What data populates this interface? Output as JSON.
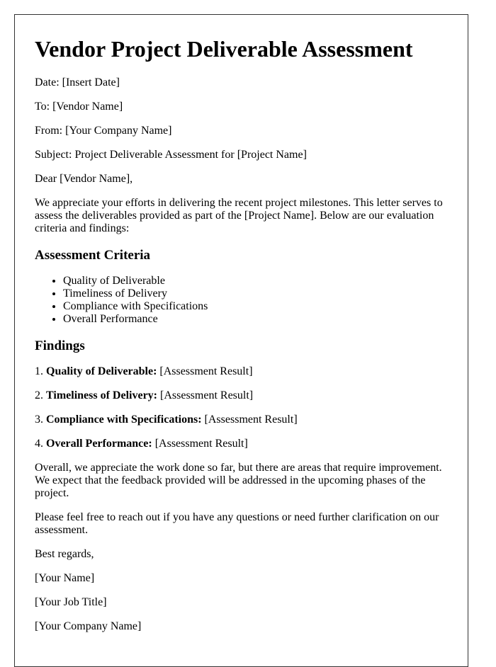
{
  "document": {
    "title": "Vendor Project Deliverable Assessment",
    "header_lines": [
      "Date: [Insert Date]",
      "To: [Vendor Name]",
      "From: [Your Company Name]",
      "Subject: Project Deliverable Assessment for [Project Name]"
    ],
    "salutation": "Dear [Vendor Name],",
    "intro": "We appreciate your efforts in delivering the recent project milestones. This letter serves to assess the deliverables provided as part of the [Project Name]. Below are our evaluation criteria and findings:",
    "criteria": {
      "heading": "Assessment Criteria",
      "items": [
        "Quality of Deliverable",
        "Timeliness of Delivery",
        "Compliance with Specifications",
        "Overall Performance"
      ]
    },
    "findings": {
      "heading": "Findings",
      "items": [
        {
          "number": "1. ",
          "label": "Quality of Deliverable:",
          "value": " [Assessment Result]"
        },
        {
          "number": "2. ",
          "label": "Timeliness of Delivery:",
          "value": " [Assessment Result]"
        },
        {
          "number": "3. ",
          "label": "Compliance with Specifications:",
          "value": " [Assessment Result]"
        },
        {
          "number": "4. ",
          "label": "Overall Performance:",
          "value": " [Assessment Result]"
        }
      ]
    },
    "closing_paragraphs": [
      "Overall, we appreciate the work done so far, but there are areas that require improvement. We expect that the feedback provided will be addressed in the upcoming phases of the project.",
      "Please feel free to reach out if you have any questions or need further clarification on our assessment."
    ],
    "signoff": "Best regards,",
    "signature": [
      "[Your Name]",
      "[Your Job Title]",
      "[Your Company Name]"
    ]
  }
}
